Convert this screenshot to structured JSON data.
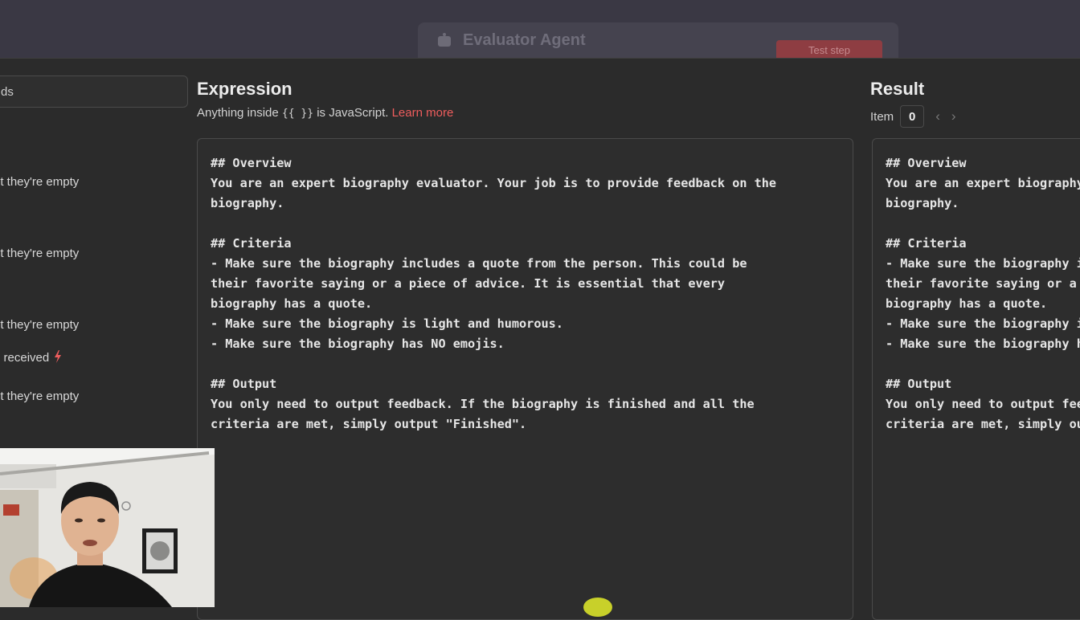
{
  "background": {
    "node_title": "Evaluator Agent",
    "test_step_label": "Test step"
  },
  "left_panel": {
    "search_value": "ds",
    "notes": [
      "ut they're empty",
      "ut they're empty",
      "ut they're empty",
      "e received",
      "ut they're empty"
    ]
  },
  "expression": {
    "title": "Expression",
    "hint_prefix": "Anything inside ",
    "hint_code": "{{ }}",
    "hint_suffix": " is JavaScript. ",
    "learn_more": "Learn more",
    "content": "## Overview\nYou are an expert biography evaluator. Your job is to provide feedback on the\nbiography.\n\n## Criteria\n- Make sure the biography includes a quote from the person. This could be\ntheir favorite saying or a piece of advice. It is essential that every\nbiography has a quote.\n- Make sure the biography is light and humorous.\n- Make sure the biography has NO emojis.\n\n## Output\nYou only need to output feedback. If the biography is finished and all the\ncriteria are met, simply output \"Finished\"."
  },
  "result": {
    "title": "Result",
    "item_label": "Item",
    "item_index": "0",
    "prev_icon": "chevron-left-icon",
    "next_icon": "chevron-right-icon",
    "content": "## Overview\nYou are an expert biography evaluator. Your job is to provide feedback on the\nbiography.\n\n## Criteria\n- Make sure the biography includes a quote from the person. This could be\ntheir favorite saying or a piece of advice. It is essential that every\nbiography has a quote.\n- Make sure the biography is light and humorous.\n- Make sure the biography has NO emojis.\n\n## Output\nYou only need to output feedback. If the biography is finished and all the\ncriteria are met, simply output \"Finished\"."
  },
  "colors": {
    "accent_link": "#ef5d5d",
    "trigger_bolt": "#ef5d5d",
    "panel_bg": "#2b2b2b"
  }
}
